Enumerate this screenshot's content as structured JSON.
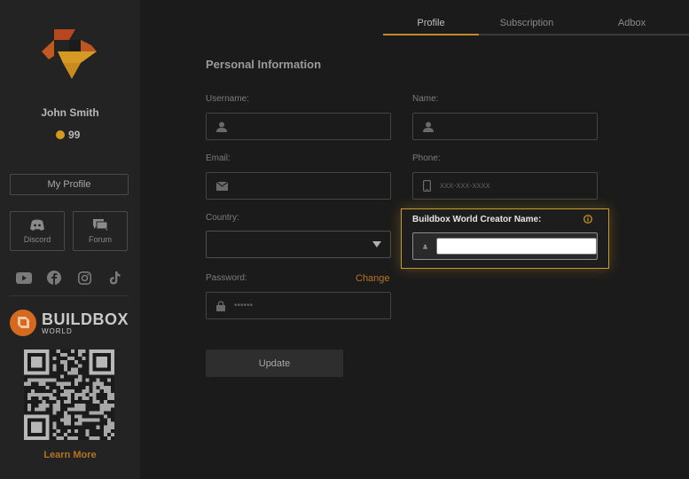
{
  "user": {
    "name": "John Smith",
    "coins": "99"
  },
  "sidebar": {
    "my_profile_label": "My Profile",
    "tiles": [
      {
        "label": "Discord",
        "icon": "discord-icon"
      },
      {
        "label": "Forum",
        "icon": "forum-icon"
      }
    ],
    "socials": [
      "youtube-icon",
      "facebook-icon",
      "instagram-icon",
      "tiktok-icon"
    ],
    "brand": {
      "name": "BUILDBOX",
      "sub": "WORLD"
    },
    "learn_more_label": "Learn More"
  },
  "tabs": [
    {
      "label": "Profile",
      "active": true
    },
    {
      "label": "Subscription",
      "active": false
    },
    {
      "label": "Adbox",
      "active": false
    }
  ],
  "form": {
    "title": "Personal Information",
    "username": {
      "label": "Username:",
      "value": "",
      "placeholder": ""
    },
    "name": {
      "label": "Name:",
      "value": "",
      "placeholder": ""
    },
    "email": {
      "label": "Email:",
      "value": "",
      "placeholder": ""
    },
    "phone": {
      "label": "Phone:",
      "value": "",
      "placeholder": "xxx-xxx-xxxx"
    },
    "country": {
      "label": "Country:",
      "value": ""
    },
    "password": {
      "label": "Password:",
      "value": "••••••",
      "change_label": "Change"
    },
    "creator": {
      "label": "Buildbox World Creator Name:",
      "value": "",
      "placeholder": ""
    },
    "update_label": "Update"
  },
  "colors": {
    "accent": "#c4892a",
    "background": "#1b1b1b",
    "sidebar": "#232323"
  }
}
